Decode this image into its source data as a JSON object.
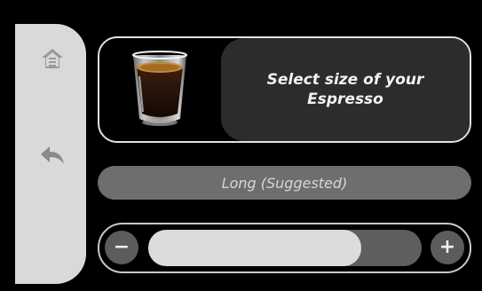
{
  "sidebar": {
    "home_icon": "home-icon",
    "back_icon": "back-arrow-icon"
  },
  "info_card": {
    "image": "espresso-cup-icon",
    "message": "Select size of your Espresso"
  },
  "size": {
    "label": "Long (Suggested)",
    "level_fraction": 0.78
  },
  "controls": {
    "minus_label": "−",
    "plus_label": "+"
  },
  "colors": {
    "background": "#000000",
    "sidebar": "#d9d9d9",
    "panel": "#2c2c2c",
    "label_bar": "#6e6e6e",
    "slider_fill": "#dcdcdc"
  }
}
